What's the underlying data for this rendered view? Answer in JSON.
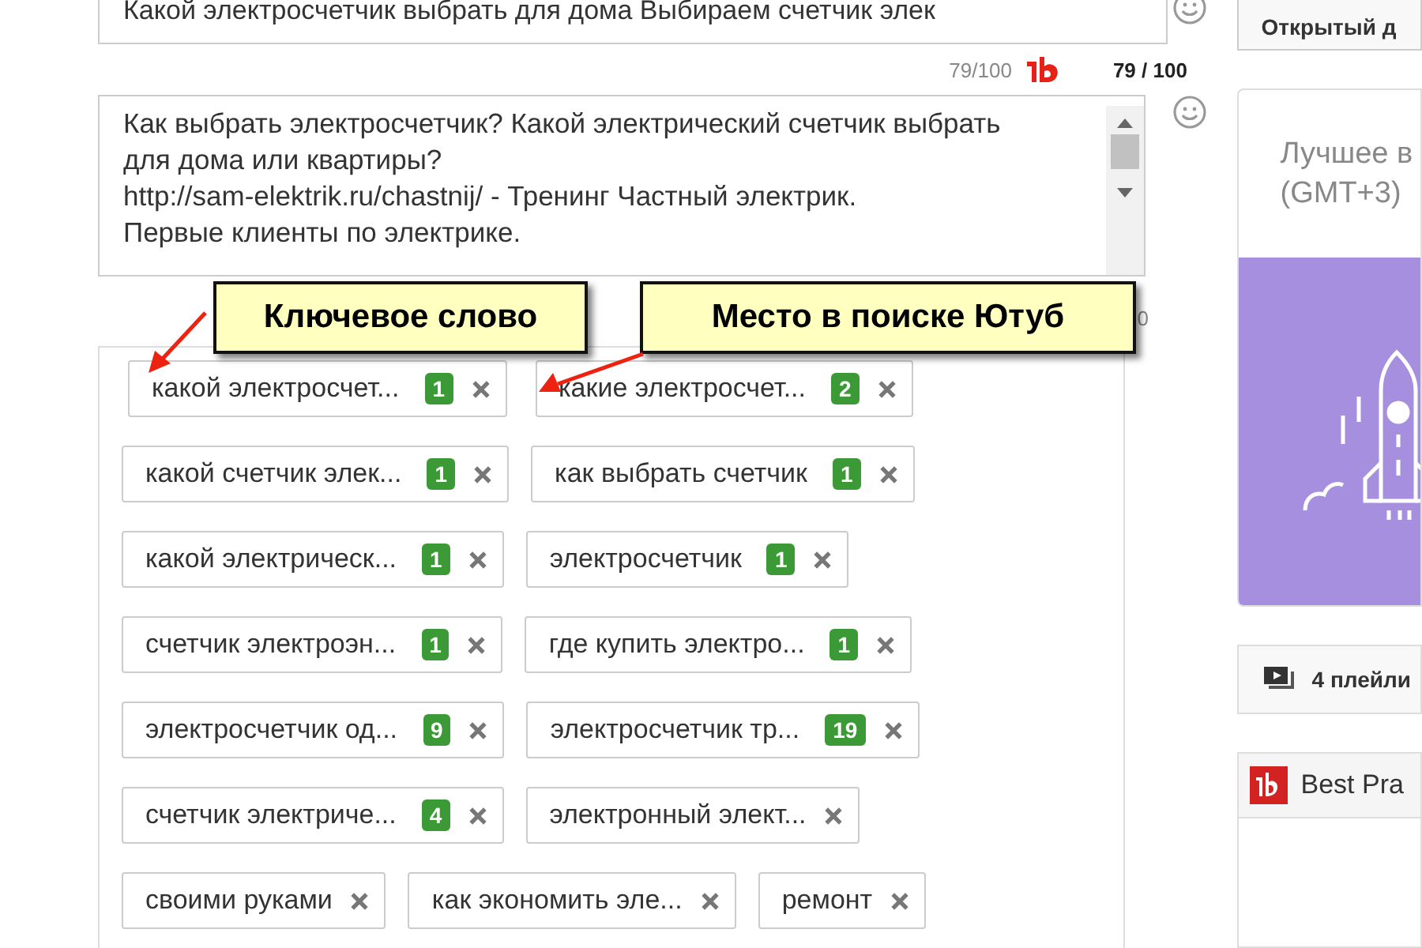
{
  "title_field": {
    "value": "Какой электросчетчик выбрать для дома Выбираем счетчик элек"
  },
  "title_counter": "79/100",
  "title_score": "79 / 100",
  "description_field": {
    "value": "Как выбрать электросчетчик? Какой электрический счетчик выбрать для дома или квартиры?\nhttp://sam-elektrik.ru/chastnij/ - Тренинг Частный электрик.\nПервые клиенты по электрике."
  },
  "tags_counter": "0",
  "tags": [
    {
      "text": "какой электросчет...",
      "rank": "1"
    },
    {
      "text": "какие электросчет...",
      "rank": "2"
    },
    {
      "text": "какой счетчик элек...",
      "rank": "1"
    },
    {
      "text": "как выбрать счетчик",
      "rank": "1"
    },
    {
      "text": "какой электрическ...",
      "rank": "1"
    },
    {
      "text": "электросчетчик",
      "rank": "1"
    },
    {
      "text": "счетчик электроэн...",
      "rank": "1"
    },
    {
      "text": "где купить электро...",
      "rank": "1"
    },
    {
      "text": "электросчетчик од...",
      "rank": "9"
    },
    {
      "text": "электросчетчик тр...",
      "rank": "19"
    },
    {
      "text": "счетчик электриче...",
      "rank": "4"
    },
    {
      "text": "электронный элект..."
    },
    {
      "text": "своими руками"
    },
    {
      "text": "как экономить эле..."
    },
    {
      "text": "ремонт"
    }
  ],
  "callouts": [
    "Ключевое слово",
    "Место в поиске Ютуб"
  ],
  "sidebar": {
    "visibility_button": "Открытый д",
    "schedule_card": {
      "title": "Лучшее в",
      "subtitle": "(GMT+3)"
    },
    "playlists_button": "4 плейли",
    "best_practices_card": {
      "title": "Best Pra"
    }
  }
}
